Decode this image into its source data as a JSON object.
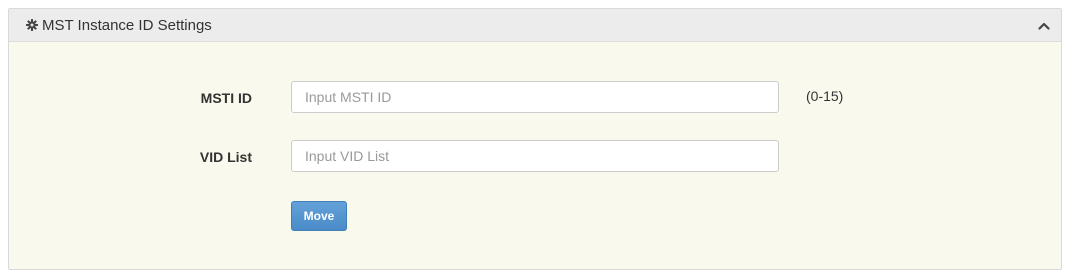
{
  "panel": {
    "title": "MST Instance ID Settings",
    "header_icon": "gear-icon",
    "collapse_icon": "chevron-up-icon"
  },
  "form": {
    "msti_id": {
      "label": "MSTI ID",
      "placeholder": "Input MSTI ID",
      "value": "",
      "range_hint": "(0-15)"
    },
    "vid_list": {
      "label": "VID List",
      "placeholder": "Input VID List",
      "value": ""
    },
    "move_button_label": "Move"
  },
  "colors": {
    "panel_background": "#f9f9ee",
    "header_background": "#ececec",
    "button_primary": "#5a97d0"
  }
}
